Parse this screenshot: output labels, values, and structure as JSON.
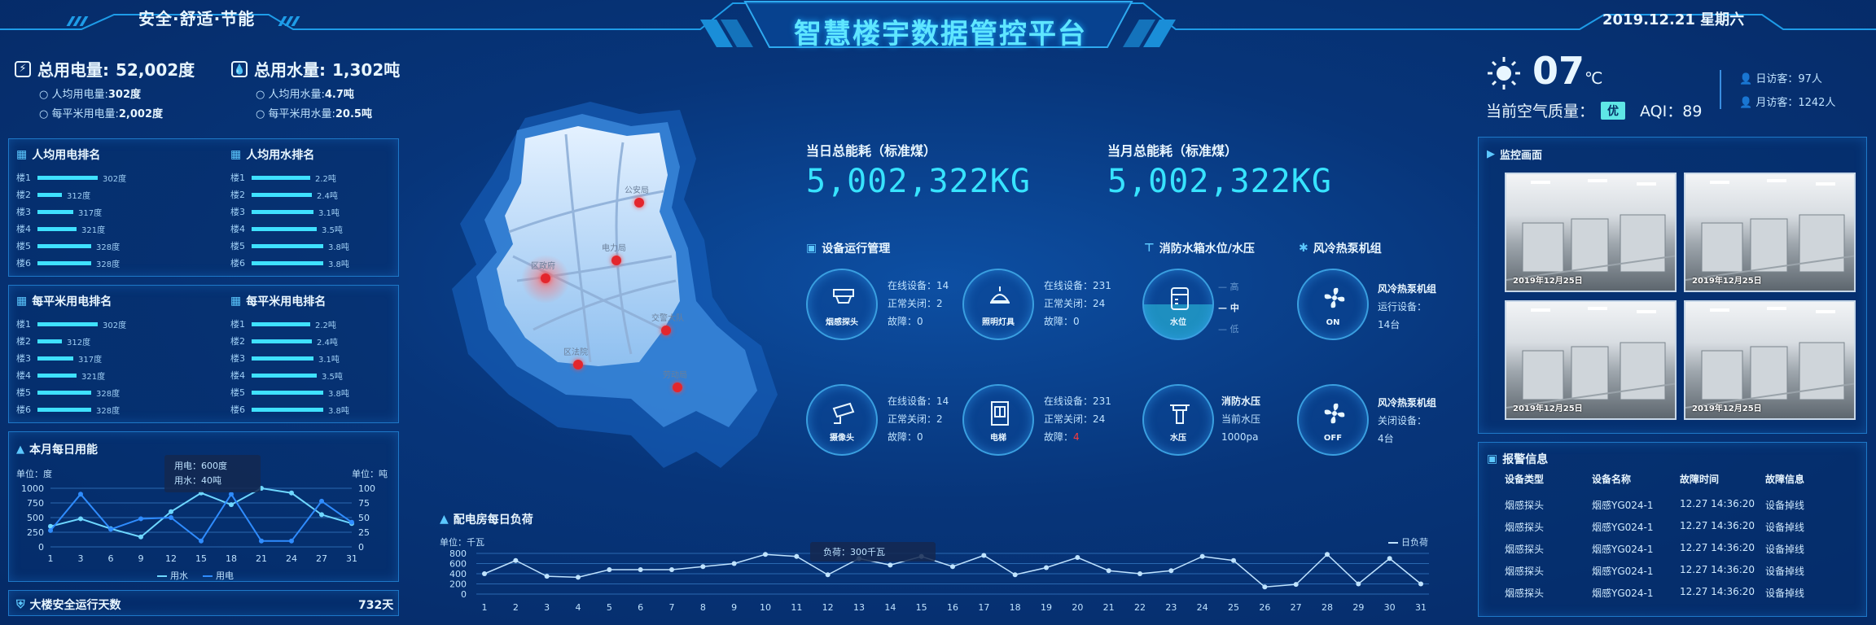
{
  "header": {
    "left_slogan": "安全·舒适·节能",
    "title": "智慧楼宇数据管控平台",
    "date": "2019.12.21 星期六"
  },
  "left_top": {
    "electric": {
      "label": "总用电量:",
      "value": "52,002度",
      "sub": [
        {
          "label": "人均用电量:",
          "value": "302度"
        },
        {
          "label": "每平米用电量:",
          "value": "2,002度"
        }
      ]
    },
    "water": {
      "label": "总用水量:",
      "value": "1,302吨",
      "sub": [
        {
          "label": "人均用水量:",
          "value": "4.7吨"
        },
        {
          "label": "每平米用水量:",
          "value": "20.5吨"
        }
      ]
    }
  },
  "ranking1": {
    "left": {
      "title": "人均用电排名",
      "rows": [
        {
          "label": "楼1",
          "value": "302度",
          "level": 0.92
        },
        {
          "label": "楼2",
          "value": "312度",
          "level": 0.38
        },
        {
          "label": "楼3",
          "value": "317度",
          "level": 0.55
        },
        {
          "label": "楼4",
          "value": "321度",
          "level": 0.6
        },
        {
          "label": "楼5",
          "value": "328度",
          "level": 0.82
        },
        {
          "label": "楼6",
          "value": "328度",
          "level": 0.82
        }
      ]
    },
    "right": {
      "title": "人均用水排名",
      "rows": [
        {
          "label": "楼1",
          "value": "2.2吨",
          "level": 0.9
        },
        {
          "label": "楼2",
          "value": "2.4吨",
          "level": 0.92
        },
        {
          "label": "楼3",
          "value": "3.1吨",
          "level": 0.95
        },
        {
          "label": "楼4",
          "value": "3.5吨",
          "level": 1.0
        },
        {
          "label": "楼5",
          "value": "3.8吨",
          "level": 1.1
        },
        {
          "label": "楼6",
          "value": "3.8吨",
          "level": 1.1
        }
      ]
    }
  },
  "ranking2": {
    "left": {
      "title": "每平米用电排名",
      "rows": [
        {
          "label": "楼1",
          "value": "302度",
          "level": 0.92
        },
        {
          "label": "楼2",
          "value": "312度",
          "level": 0.38
        },
        {
          "label": "楼3",
          "value": "317度",
          "level": 0.55
        },
        {
          "label": "楼4",
          "value": "321度",
          "level": 0.6
        },
        {
          "label": "楼5",
          "value": "328度",
          "level": 0.82
        },
        {
          "label": "楼6",
          "value": "328度",
          "level": 0.82
        }
      ]
    },
    "right": {
      "title": "每平米用电排名",
      "rows": [
        {
          "label": "楼1",
          "value": "2.2吨",
          "level": 0.9
        },
        {
          "label": "楼2",
          "value": "2.4吨",
          "level": 0.92
        },
        {
          "label": "楼3",
          "value": "3.1吨",
          "level": 0.95
        },
        {
          "label": "楼4",
          "value": "3.5吨",
          "level": 1.0
        },
        {
          "label": "楼5",
          "value": "3.8吨",
          "level": 1.1
        },
        {
          "label": "楼6",
          "value": "3.8吨",
          "level": 1.1
        }
      ]
    }
  },
  "monthly": {
    "title": "本月每日用能",
    "unit_left": "单位：度",
    "unit_right": "单位：吨",
    "tooltip": {
      "line1": "用电：600度",
      "line2": "用水：40吨"
    },
    "legend": {
      "water": "用水",
      "electric": "用电"
    }
  },
  "safety": {
    "label": "大楼安全运行天数",
    "value": "732天"
  },
  "map": {
    "places": [
      {
        "name": "公安局"
      },
      {
        "name": "电力局"
      },
      {
        "name": "区政府"
      },
      {
        "name": "交警大队"
      },
      {
        "name": "区法院"
      },
      {
        "name": "劳动局"
      }
    ]
  },
  "energy": {
    "day": {
      "label": "当日总能耗（标准煤）",
      "value": "5,002,322KG"
    },
    "month": {
      "label": "当月总能耗（标准煤）",
      "value": "5,002,322KG"
    }
  },
  "devices": {
    "title": "设备运行管理",
    "items": [
      {
        "name": "烟感探头",
        "online": "在线设备：14",
        "closed": "正常关闭：2",
        "fault_label": "故障：",
        "fault_value": "0"
      },
      {
        "name": "照明灯具",
        "online": "在线设备：231",
        "closed": "正常关闭：24",
        "fault_label": "故障：",
        "fault_value": "0"
      },
      {
        "name": "摄像头",
        "online": "在线设备：14",
        "closed": "正常关闭：2",
        "fault_label": "故障：",
        "fault_value": "0"
      },
      {
        "name": "电梯",
        "online": "在线设备：231",
        "closed": "正常关闭：24",
        "fault_label": "故障：",
        "fault_value": "4"
      }
    ]
  },
  "fire": {
    "title": "消防水箱水位/水压",
    "level_label": "水位",
    "levels": [
      "高",
      "中",
      "低"
    ],
    "pressure_label": "水压",
    "pressure_title": "消防水压",
    "pressure_current": "当前水压",
    "pressure_value": "1000pa"
  },
  "heatpump": {
    "title": "风冷热泵机组",
    "on": {
      "badge": "ON",
      "title": "风冷热泵机组",
      "sub": "运行设备：",
      "value": "14台"
    },
    "off": {
      "badge": "OFF",
      "title": "风冷热泵机组",
      "sub": "关闭设备：",
      "value": "4台"
    }
  },
  "load": {
    "title": "配电房每日负荷",
    "unit": "单位：千瓦",
    "legend": "日负荷",
    "tooltip": "负荷：300千瓦"
  },
  "weather": {
    "temp": "07",
    "unit": "℃",
    "aqi_label": "当前空气质量：",
    "aqi_badge": "优",
    "aqi_value": "AQI：89",
    "daily_visitors": "日访客：97人",
    "monthly_visitors": "月访客：1242人"
  },
  "monitor": {
    "title": "监控画面",
    "cams": [
      "2019年12月25日",
      "2019年12月25日",
      "2019年12月25日",
      "2019年12月25日"
    ]
  },
  "alarm": {
    "title": "报警信息",
    "headers": [
      "设备类型",
      "设备名称",
      "故障时间",
      "故障信息"
    ],
    "rows": [
      [
        "烟感探头",
        "烟感YG024-1",
        "12.27 14:36:20",
        "设备掉线"
      ],
      [
        "烟感探头",
        "烟感YG024-1",
        "12.27 14:36:20",
        "设备掉线"
      ],
      [
        "烟感探头",
        "烟感YG024-1",
        "12.27 14:36:20",
        "设备掉线"
      ],
      [
        "烟感探头",
        "烟感YG024-1",
        "12.27 14:36:20",
        "设备掉线"
      ],
      [
        "烟感探头",
        "烟感YG024-1",
        "12.27 14:36:20",
        "设备掉线"
      ]
    ]
  },
  "chart_data": [
    {
      "type": "line",
      "title": "本月每日用能",
      "categories": [
        "1",
        "3",
        "6",
        "9",
        "12",
        "15",
        "18",
        "21",
        "24",
        "27",
        "31"
      ],
      "ylim": [
        0,
        1000
      ],
      "y2lim": [
        0,
        100
      ],
      "yticks": [
        0,
        250,
        500,
        750,
        1000
      ],
      "y2ticks": [
        0,
        25,
        50,
        75,
        100
      ],
      "series": [
        {
          "name": "用水",
          "values": [
            35,
            48,
            31,
            17,
            60,
            92,
            72,
            100,
            92,
            55,
            40
          ],
          "axis": "right"
        },
        {
          "name": "用电",
          "values": [
            280,
            900,
            300,
            480,
            500,
            100,
            900,
            100,
            100,
            780,
            420
          ],
          "axis": "left"
        }
      ]
    },
    {
      "type": "line",
      "title": "配电房每日负荷",
      "categories": [
        "1",
        "2",
        "3",
        "4",
        "5",
        "6",
        "7",
        "8",
        "9",
        "10",
        "11",
        "12",
        "13",
        "14",
        "15",
        "16",
        "17",
        "18",
        "19",
        "20",
        "21",
        "22",
        "23",
        "24",
        "25",
        "26",
        "27",
        "28",
        "29",
        "30",
        "31"
      ],
      "ylim": [
        0,
        800
      ],
      "yticks": [
        0,
        200,
        400,
        600,
        800
      ],
      "series": [
        {
          "name": "日负荷",
          "values": [
            400,
            660,
            350,
            330,
            480,
            480,
            480,
            540,
            600,
            780,
            740,
            380,
            700,
            570,
            740,
            540,
            760,
            380,
            520,
            720,
            460,
            400,
            460,
            740,
            660,
            140,
            190,
            780,
            200,
            700,
            200
          ]
        }
      ]
    }
  ],
  "colors": {
    "accent": "#37e3ff",
    "bg": "#06347a",
    "alert": "#ff3b3b"
  }
}
